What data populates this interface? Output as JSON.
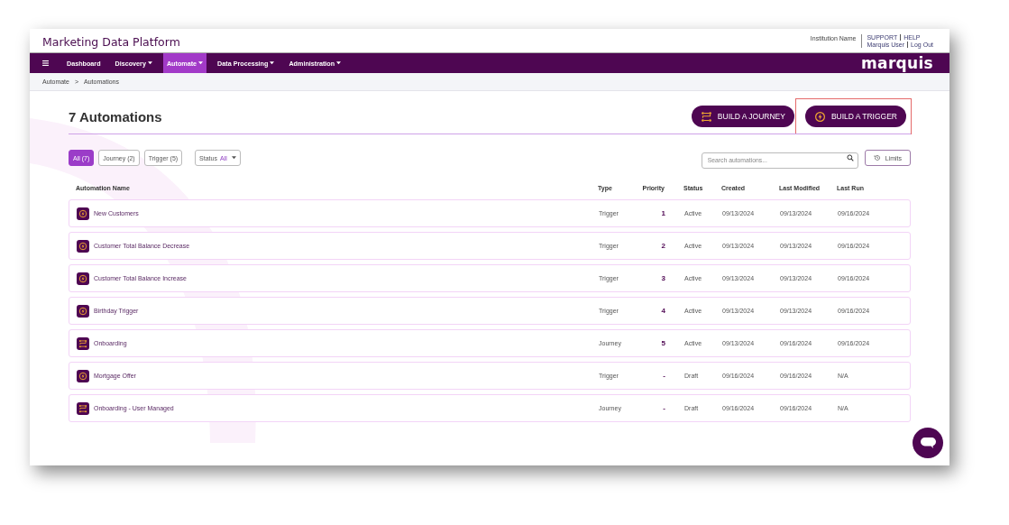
{
  "app_title": "Marketing Data Platform",
  "institution": "Institution Name",
  "top_links": [
    [
      "SUPPORT",
      "HELP"
    ],
    [
      "Marquis User",
      "Log Out"
    ]
  ],
  "nav": [
    {
      "label": "Dashboard",
      "has_menu": false,
      "selected": false
    },
    {
      "label": "Discovery",
      "has_menu": true,
      "selected": false
    },
    {
      "label": "Automate",
      "has_menu": true,
      "selected": true
    },
    {
      "label": "Data Processing",
      "has_menu": true,
      "selected": false
    },
    {
      "label": "Administration",
      "has_menu": true,
      "selected": false
    }
  ],
  "logo": "marquis",
  "breadcrumb": [
    "Automate",
    ">",
    "Automations"
  ],
  "page_title": "7 Automations",
  "actions": [
    {
      "label": "BUILD A JOURNEY",
      "kind": "journey",
      "highlighted": false
    },
    {
      "label": "BUILD A TRIGGER",
      "kind": "trigger",
      "highlighted": true
    }
  ],
  "filters": [
    {
      "label": "All (7)",
      "selected": true
    },
    {
      "label": "Journey (2)",
      "selected": false
    },
    {
      "label": "Trigger (5)",
      "selected": false
    }
  ],
  "status_filter": {
    "label": "Status",
    "value": "All"
  },
  "search": {
    "placeholder": "Search automations..."
  },
  "limits_button": "Limits",
  "table": {
    "columns": [
      "Automation Name",
      "Type",
      "Priority",
      "Status",
      "Created",
      "Last Modified",
      "Last Run"
    ],
    "rows": [
      {
        "kind": "trigger",
        "name": "New Customers",
        "type": "Trigger",
        "priority": "1",
        "status": "Active",
        "created": "09/13/2024",
        "modified": "09/13/2024",
        "last_run": "09/16/2024"
      },
      {
        "kind": "trigger",
        "name": "Customer Total Balance Decrease",
        "type": "Trigger",
        "priority": "2",
        "status": "Active",
        "created": "09/13/2024",
        "modified": "09/13/2024",
        "last_run": "09/16/2024"
      },
      {
        "kind": "trigger",
        "name": "Customer Total Balance Increase",
        "type": "Trigger",
        "priority": "3",
        "status": "Active",
        "created": "09/13/2024",
        "modified": "09/13/2024",
        "last_run": "09/16/2024"
      },
      {
        "kind": "trigger",
        "name": "Birthday Trigger",
        "type": "Trigger",
        "priority": "4",
        "status": "Active",
        "created": "09/13/2024",
        "modified": "09/13/2024",
        "last_run": "09/16/2024"
      },
      {
        "kind": "journey",
        "name": "Onboarding",
        "type": "Journey",
        "priority": "5",
        "status": "Active",
        "created": "09/13/2024",
        "modified": "09/16/2024",
        "last_run": "09/16/2024"
      },
      {
        "kind": "trigger",
        "name": "Mortgage Offer",
        "type": "Trigger",
        "priority": "-",
        "status": "Draft",
        "created": "09/16/2024",
        "modified": "09/16/2024",
        "last_run": "N/A"
      },
      {
        "kind": "journey",
        "name": "Onboarding - User Managed",
        "type": "Journey",
        "priority": "-",
        "status": "Draft",
        "created": "09/16/2024",
        "modified": "09/16/2024",
        "last_run": "N/A"
      }
    ]
  }
}
